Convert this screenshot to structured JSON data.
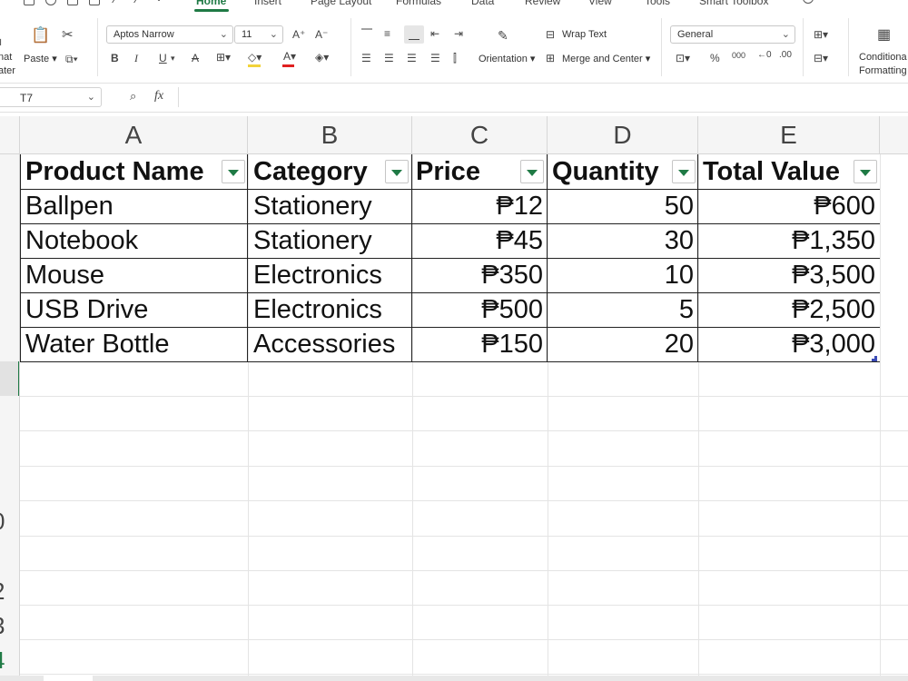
{
  "menu": {
    "tabs": [
      "Home",
      "Insert",
      "Page Layout",
      "Formulas",
      "Data",
      "Review",
      "View",
      "Tools",
      "Smart Toolbox"
    ],
    "active_tab": "Home"
  },
  "ribbon": {
    "format_painter_label_1": "nat",
    "format_painter_label_2": "ater",
    "paste_label": "Paste",
    "font_name": "Aptos Narrow",
    "font_size": "11",
    "bold": "B",
    "italic": "I",
    "underline": "U",
    "increase_font": "A⁺",
    "decrease_font": "A⁻",
    "font_color_hex": "#e02020",
    "highlight_color_hex": "#f2d33a",
    "orientation_label": "Orientation",
    "wrap_text_label": "Wrap Text",
    "merge_center_label": "Merge and Center",
    "number_format": "General",
    "percent": "%",
    "thousands": "000",
    "conditional_label_1": "Conditiona",
    "conditional_label_2": "Formatting"
  },
  "formula_bar": {
    "name_box": "T7",
    "fx_label": "fx",
    "formula": ""
  },
  "columns": [
    "A",
    "B",
    "C",
    "D",
    "E"
  ],
  "row_numbers_partial": [
    "0",
    "2",
    "3",
    "4",
    "5"
  ],
  "table": {
    "headers": [
      "Product Name",
      "Category",
      "Price",
      "Quantity",
      "Total Value"
    ],
    "rows": [
      [
        "Ballpen",
        "Stationery",
        "₱12",
        "50",
        "₱600"
      ],
      [
        "Notebook",
        "Stationery",
        "₱45",
        "30",
        "₱1,350"
      ],
      [
        "Mouse",
        "Electronics",
        "₱350",
        "10",
        "₱3,500"
      ],
      [
        "USB Drive",
        "Electronics",
        "₱500",
        "5",
        "₱2,500"
      ],
      [
        "Water Bottle",
        "Accessories",
        "₱150",
        "20",
        "₱3,000"
      ]
    ]
  },
  "colors": {
    "accent": "#1f7a45",
    "selection_handle": "#3b4bb5"
  }
}
